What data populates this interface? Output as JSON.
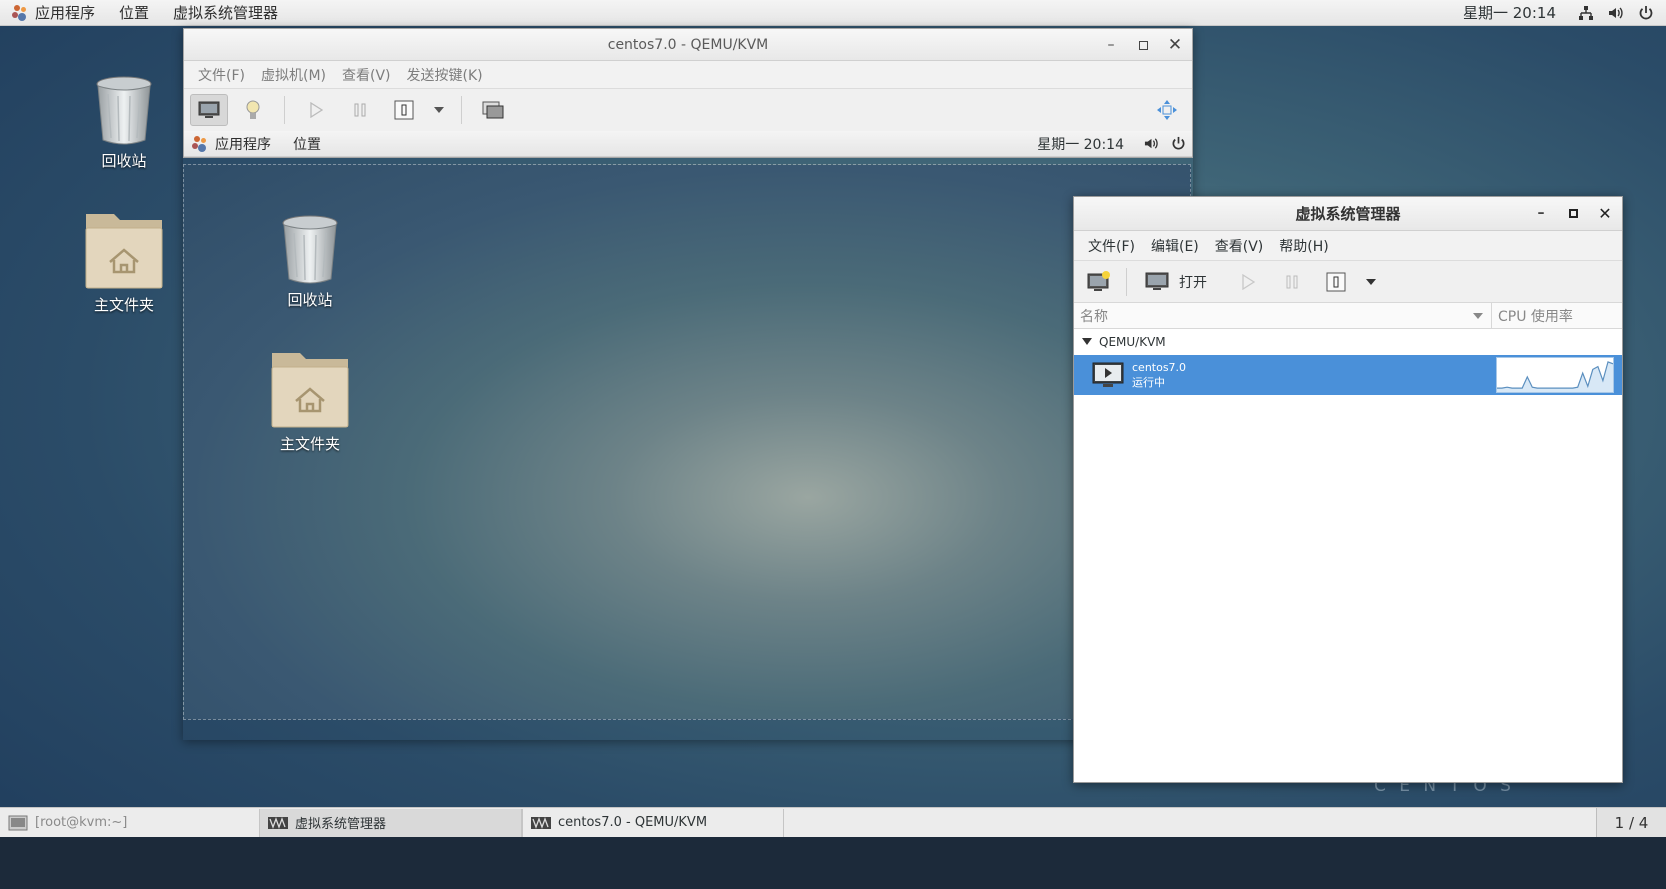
{
  "top_panel": {
    "applications": "应用程序",
    "places": "位置",
    "active_app": "虚拟系统管理器",
    "clock": "星期一 20:14"
  },
  "desktop": {
    "icons": [
      {
        "label": "回收站"
      },
      {
        "label": "主文件夹"
      }
    ],
    "watermark": "C E N T O S"
  },
  "qemu_window": {
    "title": "centos7.0 - QEMU/KVM",
    "menu": [
      "文件(F)",
      "虚拟机(M)",
      "查看(V)",
      "发送按键(K)"
    ],
    "guest": {
      "applications": "应用程序",
      "places": "位置",
      "clock": "星期一 20:14",
      "icons": [
        {
          "label": "回收站"
        },
        {
          "label": "主文件夹"
        }
      ]
    }
  },
  "vmm_window": {
    "title": "虚拟系统管理器",
    "menu": [
      "文件(F)",
      "编辑(E)",
      "查看(V)",
      "帮助(H)"
    ],
    "open_label": "打开",
    "columns": {
      "name": "名称",
      "cpu": "CPU 使用率"
    },
    "group": "QEMU/KVM",
    "vms": [
      {
        "name": "centos7.0",
        "status": "运行中",
        "cpu_history": [
          2,
          2,
          3,
          2,
          2,
          2,
          14,
          3,
          2,
          2,
          2,
          2,
          2,
          2,
          2,
          2,
          3,
          18,
          4,
          22,
          25,
          10,
          30,
          28
        ]
      }
    ],
    "accent": "#4a90d9"
  },
  "taskbar": {
    "tasks": [
      {
        "label": "[root@kvm:~]"
      },
      {
        "label": "虚拟系统管理器"
      },
      {
        "label": "centos7.0 - QEMU/KVM"
      }
    ],
    "pager": "1 / 4"
  }
}
